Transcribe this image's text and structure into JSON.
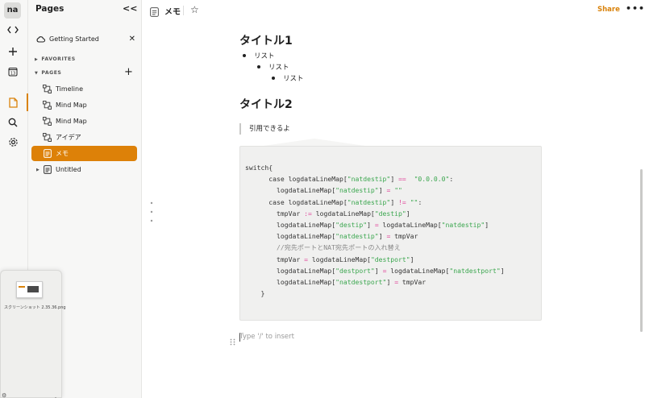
{
  "rail": {
    "workspace_badge": "na",
    "icons": [
      "code-brackets-icon",
      "plus-icon",
      "calendar-icon",
      "document-icon",
      "search-icon",
      "settings-icon"
    ],
    "calendar_day": "13"
  },
  "sidebar": {
    "title": "Pages",
    "collapse_label": "<<",
    "getting_started": "Getting Started",
    "favorites_label": "FAVORITES",
    "pages_label": "PAGES",
    "pages": [
      {
        "label": "Timeline",
        "icon": "map-icon"
      },
      {
        "label": "Mind Map",
        "icon": "map-icon"
      },
      {
        "label": "Mind Map",
        "icon": "map-icon"
      },
      {
        "label": "アイデア",
        "icon": "map-icon"
      },
      {
        "label": "メモ",
        "icon": "document-icon",
        "active": true
      },
      {
        "label": "Untitled",
        "icon": "document-icon"
      }
    ]
  },
  "popup": {
    "filename": "スクリーンショット 2.35.36.png"
  },
  "topbar": {
    "doc_title": "メモ",
    "share_label": "Share",
    "more_label": "•••"
  },
  "document": {
    "heading1": "タイトル1",
    "list": [
      {
        "text": "リスト",
        "level": 1
      },
      {
        "text": "リスト",
        "level": 2
      },
      {
        "text": "リスト",
        "level": 3
      }
    ],
    "heading2": "タイトル2",
    "quote": "引用できるよ",
    "code": [
      "switch{",
      "      case logdataLineMap[\"natdestip\"] ==  \"0.0.0.0\":",
      "        logdataLineMap[\"natdestip\"] = \"\"",
      "      case logdataLineMap[\"natdestip\"] != \"\":",
      "        tmpVar := logdataLineMap[\"destip\"]",
      "        logdataLineMap[\"destip\"] = logdataLineMap[\"natdestip\"]",
      "        logdataLineMap[\"natdestip\"] = tmpVar",
      "        //宛先ポートとNAT宛先ポートの入れ替え",
      "        tmpVar = logdataLineMap[\"destport\"]",
      "        logdataLineMap[\"destport\"] = logdataLineMap[\"natdestport\"]",
      "        logdataLineMap[\"natdestport\"] = tmpVar",
      "    }"
    ],
    "placeholder": "Type '/' to insert"
  },
  "colors": {
    "accent": "#dd8108",
    "code_string": "#3aa64e",
    "code_operator": "#e0459a"
  }
}
